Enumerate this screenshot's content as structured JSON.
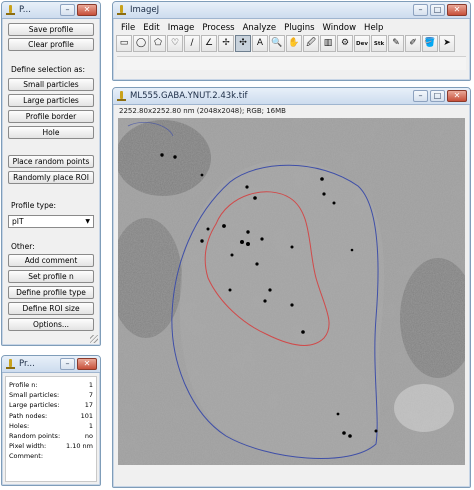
{
  "plugin_panel": {
    "title": "P...",
    "buttons": {
      "save_profile": "Save profile",
      "clear_profile": "Clear profile",
      "small_particles": "Small particles",
      "large_particles": "Large particles",
      "profile_border": "Profile border",
      "hole": "Hole",
      "place_random_points": "Place random points",
      "randomly_place_roi": "Randomly place ROI",
      "add_comment": "Add comment",
      "set_profile_n": "Set profile n",
      "define_profile_type": "Define profile type",
      "define_roi_size": "Define ROI size",
      "options": "Options..."
    },
    "labels": {
      "define_selection": "Define selection as:",
      "profile_type": "Profile type:",
      "other": "Other:"
    },
    "profile_type_value": "pIT"
  },
  "stats_panel": {
    "title": "Pr...",
    "rows": [
      {
        "label": "Profile n:",
        "value": "1"
      },
      {
        "label": "Small particles:",
        "value": "7"
      },
      {
        "label": "Large particles:",
        "value": "17"
      },
      {
        "label": "Path nodes:",
        "value": "101"
      },
      {
        "label": "Holes:",
        "value": "1"
      },
      {
        "label": "Random points:",
        "value": "no"
      },
      {
        "label": "Pixel width:",
        "value": "1.10 nm"
      },
      {
        "label": "Comment:",
        "value": ""
      }
    ]
  },
  "imagej": {
    "title": "ImageJ",
    "menus": [
      "File",
      "Edit",
      "Image",
      "Process",
      "Analyze",
      "Plugins",
      "Window",
      "Help"
    ],
    "tools": [
      {
        "name": "rectangle-tool-icon",
        "glyph": "▭"
      },
      {
        "name": "oval-tool-icon",
        "glyph": "◯"
      },
      {
        "name": "polygon-tool-icon",
        "glyph": "⬠"
      },
      {
        "name": "freehand-tool-icon",
        "glyph": "♡"
      },
      {
        "name": "line-tool-icon",
        "glyph": "∕"
      },
      {
        "name": "angle-tool-icon",
        "glyph": "∠"
      },
      {
        "name": "point-tool-icon",
        "glyph": "✢"
      },
      {
        "name": "wand-tool-icon",
        "glyph": "✣"
      },
      {
        "name": "text-tool-icon",
        "glyph": "A"
      },
      {
        "name": "magnifier-tool-icon",
        "glyph": "🔍"
      },
      {
        "name": "hand-tool-icon",
        "glyph": "✋"
      },
      {
        "name": "color-picker-tool-icon",
        "glyph": "🖉"
      },
      {
        "name": "lut-tool-icon",
        "glyph": "▥"
      },
      {
        "name": "developer-menu-icon",
        "glyph": "⚙"
      },
      {
        "name": "dev-menu-icon",
        "glyph": "Dev"
      },
      {
        "name": "stack-menu-icon",
        "glyph": "Stk"
      },
      {
        "name": "brush-tool-icon",
        "glyph": "✎"
      },
      {
        "name": "drawing-tools-icon",
        "glyph": "✐"
      },
      {
        "name": "flood-fill-icon",
        "glyph": "🪣"
      },
      {
        "name": "arrow-tool-icon",
        "glyph": "➤"
      }
    ]
  },
  "image_window": {
    "title": "ML555.GABA.YNUT.2.43k.tif",
    "info": "2252.80x2252.80 nm (2048x2048); RGB; 16MB"
  },
  "colors": {
    "profile_outline": "#3f4fa8",
    "hole_outline": "#d04a4a",
    "particle": "#000000"
  }
}
